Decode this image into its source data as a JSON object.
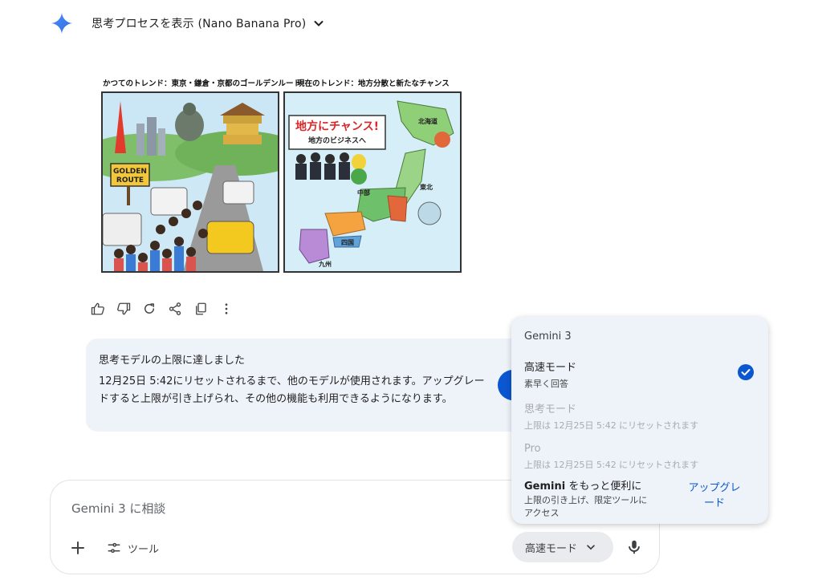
{
  "header": {
    "title": "思考プロセスを表示 (Nano Banana Pro)"
  },
  "illustration": {
    "left_caption": "かつてのトレンド：東京・鎌倉・京都のゴールデンルート",
    "right_caption": "現在のトレンド：地方分散と新たなチャンス",
    "sign_line1": "GOLDEN",
    "sign_line2": "ROUTE",
    "banner_line1": "地方にチャンス!",
    "banner_line2": "地方のビジネスへ",
    "regions": {
      "hokkaido": "北海道",
      "tohoku": "東北",
      "chubu": "中部",
      "shikoku": "四国",
      "kyushu": "九州"
    }
  },
  "limit_notice": {
    "title": "思考モデルの上限に達しました",
    "body": "12月25日 5:42にリセットされるまで、他のモデルが使用されます。アップグレードすると上限が引き上げられ、その他の機能も利用できるようになります。"
  },
  "input": {
    "placeholder": "Gemini 3 に相談",
    "tools_label": "ツール",
    "mode_label": "高速モード"
  },
  "dropdown": {
    "heading": "Gemini 3",
    "items": [
      {
        "title": "高速モード",
        "desc": "素早く回答",
        "selected": true
      },
      {
        "title": "思考モード",
        "desc": "上限は 12月25日 5:42 にリセットされます",
        "selected": false
      },
      {
        "title": "Pro",
        "desc": "上限は 12月25日 5:42 にリセットされます",
        "selected": false
      }
    ],
    "promo_title_bold": "Gemini",
    "promo_title_rest": " をもっと便利に",
    "promo_desc": "上限の引き上げ、限定ツールにアクセス",
    "upgrade_label": "アップグレード"
  },
  "colors": {
    "accent": "#0b57d0",
    "panel": "#eef2f9"
  }
}
